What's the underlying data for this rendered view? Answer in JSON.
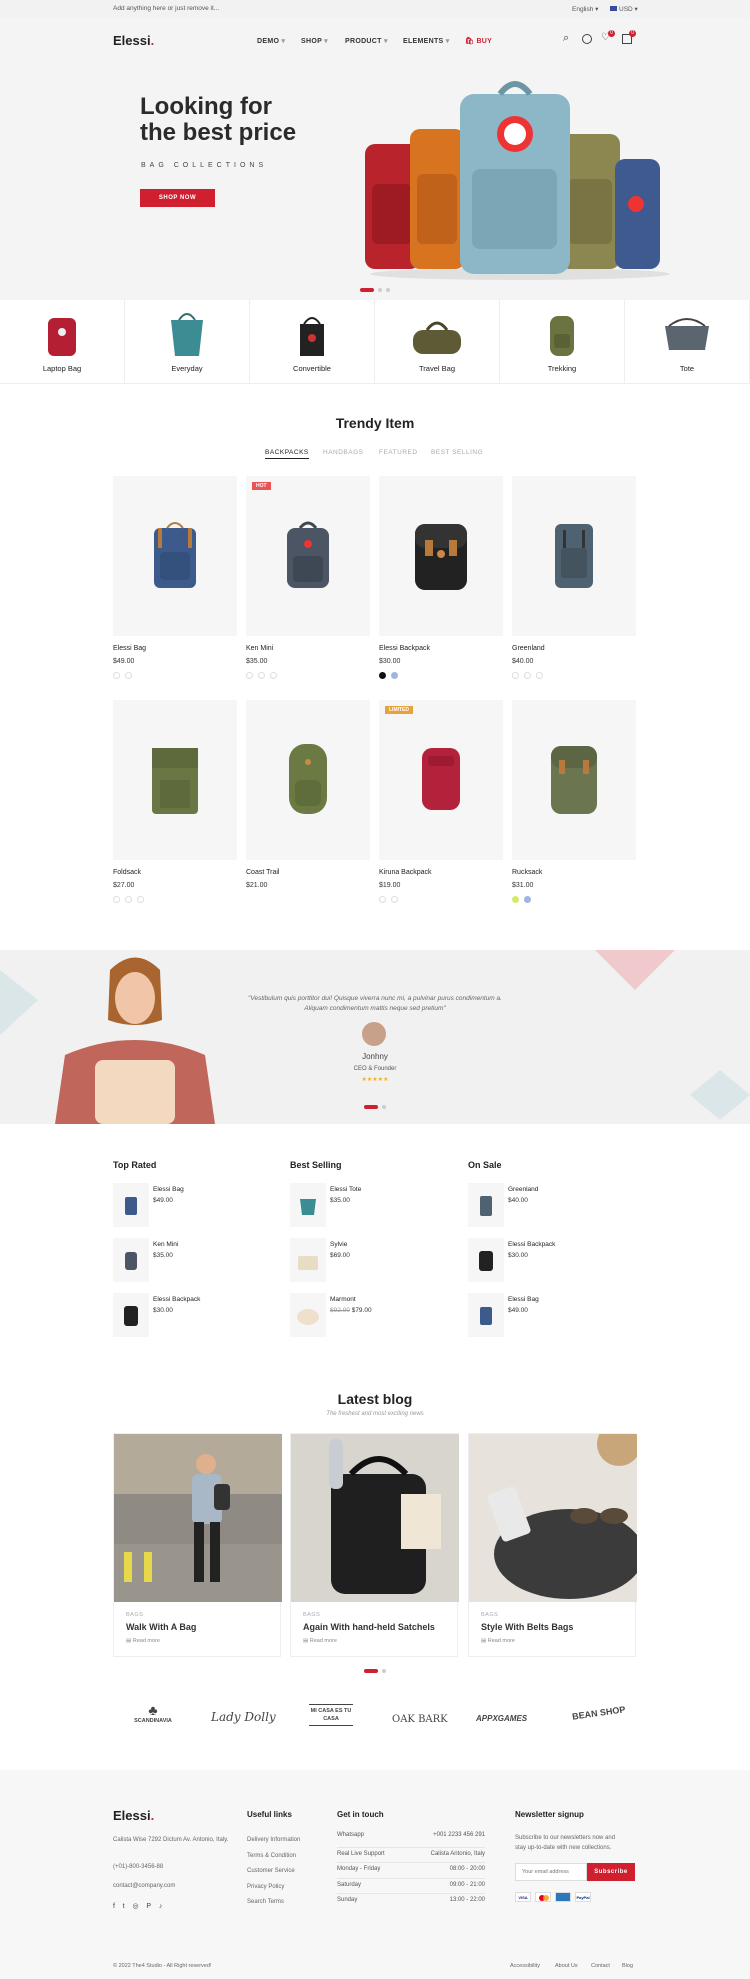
{
  "topbar": {
    "promo": "Add anything here or just remove it...",
    "language": "English",
    "currency": "USD"
  },
  "header": {
    "logo": "Elessi",
    "logo_dot": ".",
    "nav": [
      "DEMO",
      "SHOP",
      "PRODUCT",
      "ELEMENTS"
    ],
    "buy": "BUY",
    "wishlist_count": "0",
    "cart_count": "0"
  },
  "hero": {
    "title_line1": "Looking for",
    "title_line2": "the best price",
    "subtitle": "BAG COLLECTIONS",
    "button": "SHOP NOW"
  },
  "categories": [
    "Laptop Bag",
    "Everyday",
    "Convertible",
    "Travel Bag",
    "Trekking",
    "Tote"
  ],
  "trendy": {
    "title": "Trendy Item",
    "tabs": [
      "BACKPACKS",
      "HANDBAGS",
      "FEATURED",
      "BEST SELLING"
    ],
    "products": [
      {
        "name": "Elessi Bag",
        "price": "$49.00"
      },
      {
        "name": "Ken Mini",
        "price": "$35.00",
        "badge": "HOT"
      },
      {
        "name": "Elessi Backpack",
        "price": "$30.00"
      },
      {
        "name": "Greenland",
        "price": "$40.00"
      },
      {
        "name": "Foldsack",
        "price": "$27.00"
      },
      {
        "name": "Coast Trail",
        "price": "$21.00"
      },
      {
        "name": "Kiruna Backpack",
        "price": "$19.00",
        "badge": "LIMITED"
      },
      {
        "name": "Rucksack",
        "price": "$31.00"
      }
    ]
  },
  "testimonial": {
    "quote_line1": "\"Vestibulum quis porttitor dui! Quisque viverra nunc mi, a pulvinar purus condimentum a.",
    "quote_line2": "Aliquam condimentum mattis neque sed pretium\"",
    "name": "Jonhny",
    "role": "CEO & Founder",
    "stars": "★★★★★"
  },
  "lists": {
    "top_rated": {
      "title": "Top Rated",
      "items": [
        {
          "name": "Elessi Bag",
          "price": "$49.00"
        },
        {
          "name": "Ken Mini",
          "price": "$35.00"
        },
        {
          "name": "Elessi Backpack",
          "price": "$30.00"
        }
      ]
    },
    "best_selling": {
      "title": "Best Selling",
      "items": [
        {
          "name": "Elessi Tote",
          "price": "$35.00"
        },
        {
          "name": "Sylvie",
          "price": "$69.00"
        },
        {
          "name": "Marmont",
          "price_old": "$92.00",
          "price": "$79.00"
        }
      ]
    },
    "on_sale": {
      "title": "On Sale",
      "items": [
        {
          "name": "Greenland",
          "price": "$40.00"
        },
        {
          "name": "Elessi Backpack",
          "price": "$30.00"
        },
        {
          "name": "Elessi Bag",
          "price": "$49.00"
        }
      ]
    }
  },
  "blog": {
    "title": "Latest blog",
    "subtitle": "The freshest and most exciting news",
    "posts": [
      {
        "cat": "BAGS",
        "title": "Walk With A Bag",
        "more": "Read more"
      },
      {
        "cat": "BAGS",
        "title": "Again With hand-held Satchels",
        "more": "Read more"
      },
      {
        "cat": "BAGS",
        "title": "Style With Belts Bags",
        "more": "Read more"
      }
    ]
  },
  "brands": [
    "SCANDINAVIA",
    "Lady Dolly",
    "MI CASA ES TU CASA",
    "OAK BARK",
    "APPXGAMES",
    "BEAN SHOP"
  ],
  "footer": {
    "address": "Calista Wise 7292 Dictum Av. Antonio, Italy.",
    "phone": "(+01)-800-3456-88",
    "email": "contact@company.com",
    "useful_title": "Useful links",
    "useful": [
      "Delivery Information",
      "Terms & Condition",
      "Customer Service",
      "Privacy Policy",
      "Search Terms"
    ],
    "touch_title": "Get in touch",
    "touch": [
      [
        "Whatsapp",
        "+001 2233 456 291"
      ],
      [
        "Real Live Support",
        "Calista Antonio, Italy"
      ],
      [
        "Monday - Friday",
        "08:00 - 20:00"
      ],
      [
        "Saturday",
        "09:00 - 21:00"
      ],
      [
        "Sunday",
        "13:00 - 22:00"
      ]
    ],
    "news_title": "Newsletter signup",
    "news_text_1": "Subscribe to our newsletters now and",
    "news_text_2": "stay up-to-date with new collections.",
    "email_placeholder": "Your email address",
    "subscribe": "Subscribe",
    "copyright": "© 2022 The4 Studio - All Right reserved!",
    "bottom_links": [
      "Accessibility",
      "About Us",
      "Contact",
      "Blog"
    ]
  }
}
